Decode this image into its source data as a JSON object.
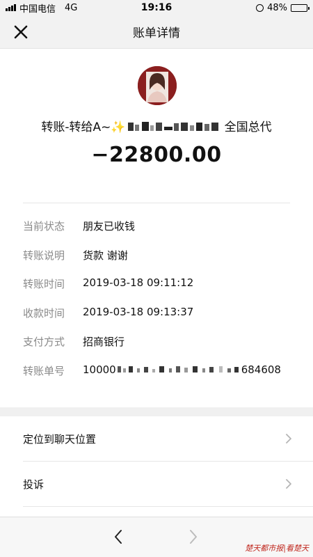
{
  "status_bar": {
    "carrier": "中国电信",
    "network": "4G",
    "time": "19:16",
    "battery": "48%",
    "battery_level": 0.48
  },
  "nav": {
    "title": "账单详情",
    "close_icon": "close-icon"
  },
  "transfer": {
    "payee": "转账-转给A~✨",
    "payee_suffix": "全国总代",
    "amount": "−22800.00"
  },
  "details": [
    {
      "label": "当前状态",
      "value": "朋友已收钱"
    },
    {
      "label": "转账说明",
      "value": "货款 谢谢"
    },
    {
      "label": "转账时间",
      "value": "2019-03-18 09:11:12"
    },
    {
      "label": "收款时间",
      "value": "2019-03-18 09:13:37"
    },
    {
      "label": "支付方式",
      "value": "招商银行"
    },
    {
      "label": "转账单号",
      "value_prefix": "10000",
      "value_suffix": "684608"
    }
  ],
  "actions": [
    {
      "label": "定位到聊天位置",
      "icon": "chevron-right-icon"
    },
    {
      "label": "投诉",
      "icon": "chevron-right-icon"
    }
  ],
  "toolbar": {
    "back_icon": "chevron-left-icon",
    "forward_icon": "chevron-right-icon"
  },
  "watermark": "楚天都市报|看楚天",
  "colors": {
    "accent_text": "#111111",
    "label_gray": "#8a8a8a",
    "bar_gray": "#f2f2f2",
    "watermark_red": "#c0281f"
  }
}
